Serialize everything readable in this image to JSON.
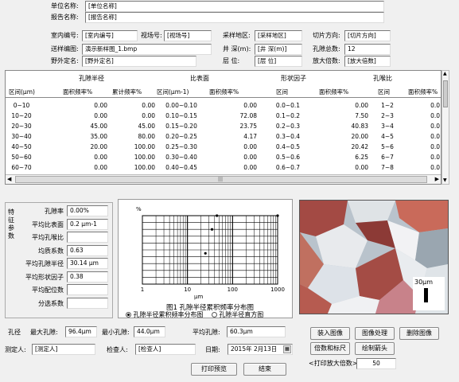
{
  "header": {
    "unit_label": "单位名称:",
    "unit_value": "[单位名称]",
    "report_label": "报告名称:",
    "report_value": "[报告名称]"
  },
  "info": {
    "indoor_no_label": "室内编号:",
    "indoor_no_value": "[室内编号]",
    "field_no_label": "视场号:",
    "field_no_value": "[视场号]",
    "sampling_area_label": "采样地区:",
    "sampling_area_value": "[采样地区]",
    "slice_dir_label": "切片方向:",
    "slice_dir_value": "[切片方向]",
    "sample_image_label": "送样编图:",
    "sample_image_value": "演示新样图_1.bmp",
    "well_depth_label": "井 深(m):",
    "well_depth_value": "[井 深(m)]",
    "pore_total_label": "孔隙总数:",
    "pore_total_value": "12",
    "field_name_label": "野外定名:",
    "field_name_value": "[野外定名]",
    "layer_label": "层  位:",
    "layer_value": "[层  位]",
    "magnification_label": "放大倍数:",
    "magnification_value": "[放大倍数]"
  },
  "table": {
    "groups": [
      "孔隙半径",
      "比表面",
      "形状因子",
      "孔喉比"
    ],
    "headers": [
      "区间(μm)",
      "面积频率%",
      "累计频率%",
      "区间(μm-1)",
      "面积频率%",
      "区间",
      "面积频率%",
      "区间",
      "面积频率%"
    ],
    "rows": [
      [
        "0~10",
        "0.00",
        "0.00",
        "0.00~0.10",
        "0.00",
        "0.0~0.1",
        "0.00",
        "1~2",
        "0.0"
      ],
      [
        "10~20",
        "0.00",
        "0.00",
        "0.10~0.15",
        "72.08",
        "0.1~0.2",
        "7.50",
        "2~3",
        "0.0"
      ],
      [
        "20~30",
        "45.00",
        "45.00",
        "0.15~0.20",
        "23.75",
        "0.2~0.3",
        "40.83",
        "3~4",
        "0.0"
      ],
      [
        "30~40",
        "35.00",
        "80.00",
        "0.20~0.25",
        "4.17",
        "0.3~0.4",
        "20.00",
        "4~5",
        "0.0"
      ],
      [
        "40~50",
        "20.00",
        "100.00",
        "0.25~0.30",
        "0.00",
        "0.4~0.5",
        "20.42",
        "5~6",
        "0.0"
      ],
      [
        "50~60",
        "0.00",
        "100.00",
        "0.30~0.40",
        "0.00",
        "0.5~0.6",
        "6.25",
        "6~7",
        "0.0"
      ],
      [
        "60~70",
        "0.00",
        "100.00",
        "0.40~0.45",
        "0.00",
        "0.6~0.7",
        "0.00",
        "7~8",
        "0.0"
      ]
    ]
  },
  "features": {
    "side_title": "特征参数",
    "items": [
      {
        "label": "孔隙率",
        "value": "0.00%"
      },
      {
        "label": "平均比表面",
        "value": "0.2 μm-1"
      },
      {
        "label": "平均孔喉比",
        "value": ""
      },
      {
        "label": "均质系数",
        "value": "0.63"
      },
      {
        "label": "平均孔隙半径",
        "value": "30.14 μm"
      },
      {
        "label": "平均形状因子",
        "value": "0.38"
      },
      {
        "label": "平均配位数",
        "value": ""
      },
      {
        "label": "分选系数",
        "value": ""
      }
    ]
  },
  "chart_data": {
    "type": "scatter",
    "title": "图1 孔隙半径累积频率分布图",
    "xlabel": "μm",
    "ylabel": "%",
    "xscale": "log",
    "xlim": [
      1,
      1000
    ],
    "ylim": [
      0,
      100
    ],
    "xticks": [
      "1",
      "10",
      "100",
      "1000"
    ],
    "x": [
      25,
      35,
      45,
      1000
    ],
    "y": [
      45,
      80,
      100,
      100
    ]
  },
  "chart_options": {
    "option1": "孔隙半径累积频率分布图",
    "option2": "孔隙半径直方图"
  },
  "photo": {
    "scale_label": "30μm"
  },
  "pore": {
    "label": "孔径",
    "max_label": "最大孔隙:",
    "max_value": "96.4μm",
    "min_label": "最小孔隙:",
    "min_value": "44.0μm",
    "avg_label": "平均孔隙:",
    "avg_value": "60.3μm"
  },
  "people": {
    "assessor_label": "测定人:",
    "assessor_value": "[测定人]",
    "checker_label": "检查人:",
    "checker_value": "[检查人]",
    "date_label": "日期:",
    "date_value": "2015年 2月13日"
  },
  "buttons": {
    "load_image": "装入图像",
    "process_image": "图像处理",
    "delete_image": "删除图像",
    "grid_scale": "倍数和标尺",
    "draw_arrow": "绘制箭头",
    "print_preview": "打印预览",
    "finish": "结束"
  },
  "print_mag": {
    "label": "<打印放大倍数>",
    "value": "50"
  }
}
